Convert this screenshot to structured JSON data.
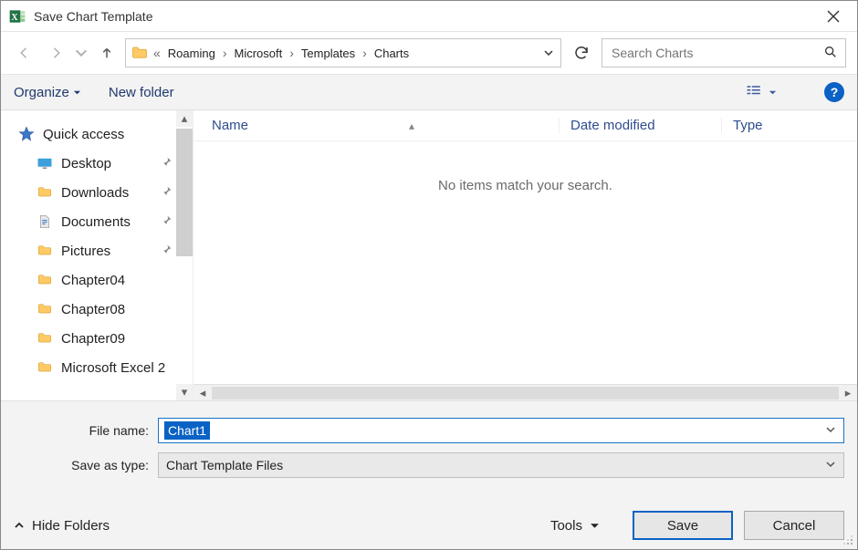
{
  "window": {
    "title": "Save Chart Template"
  },
  "nav": {
    "crumbs": [
      "Roaming",
      "Microsoft",
      "Templates",
      "Charts"
    ],
    "overflow_indicator": "«"
  },
  "search": {
    "placeholder": "Search Charts"
  },
  "toolbar": {
    "organize": "Organize",
    "new_folder": "New folder"
  },
  "sidebar": {
    "quick_access": "Quick access",
    "items": [
      {
        "label": "Desktop",
        "pinned": true,
        "icon": "desktop-icon"
      },
      {
        "label": "Downloads",
        "pinned": true,
        "icon": "folder-icon"
      },
      {
        "label": "Documents",
        "pinned": true,
        "icon": "document-icon"
      },
      {
        "label": "Pictures",
        "pinned": true,
        "icon": "folder-icon"
      },
      {
        "label": "Chapter04",
        "pinned": false,
        "icon": "folder-icon"
      },
      {
        "label": "Chapter08",
        "pinned": false,
        "icon": "folder-icon"
      },
      {
        "label": "Chapter09",
        "pinned": false,
        "icon": "folder-icon"
      },
      {
        "label": "Microsoft Excel 2",
        "pinned": false,
        "icon": "folder-icon"
      }
    ]
  },
  "columns": {
    "name": "Name",
    "date": "Date modified",
    "type": "Type"
  },
  "content": {
    "empty_message": "No items match your search."
  },
  "form": {
    "filename_label": "File name:",
    "filename_value": "Chart1",
    "savetype_label": "Save as type:",
    "savetype_value": "Chart Template Files"
  },
  "footer": {
    "hide_folders": "Hide Folders",
    "tools": "Tools",
    "save": "Save",
    "cancel": "Cancel"
  }
}
